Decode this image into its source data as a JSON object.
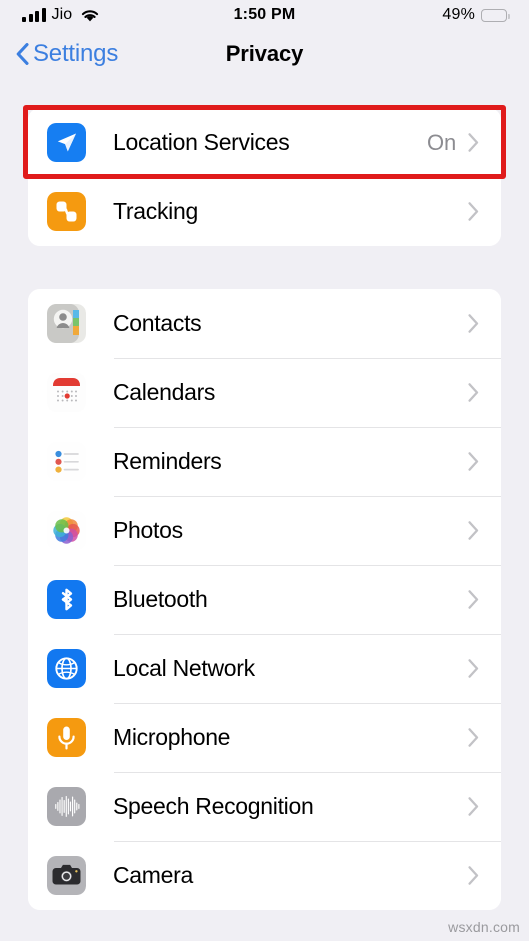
{
  "status_bar": {
    "carrier": "Jio",
    "signal_icon": "signal-bars-icon",
    "wifi_icon": "wifi-icon",
    "time": "1:50 PM",
    "battery_percent": "49%",
    "battery_icon": "battery-icon",
    "battery_level": 49
  },
  "nav": {
    "back_icon": "chevron-left-icon",
    "back_label": "Settings",
    "title": "Privacy"
  },
  "groups": [
    {
      "rows": [
        {
          "label": "Location Services",
          "value": "On",
          "icon": "location-arrow-icon",
          "icon_color": "#167ef2",
          "highlighted": true
        },
        {
          "label": "Tracking",
          "value": "",
          "icon": "tracking-icon",
          "icon_color": "#f59a10",
          "highlighted": false
        }
      ]
    },
    {
      "rows": [
        {
          "label": "Contacts",
          "value": "",
          "icon": "contacts-icon",
          "icon_color": "#c9c9c6",
          "highlighted": false
        },
        {
          "label": "Calendars",
          "value": "",
          "icon": "calendar-icon",
          "icon_color": "#ffffff",
          "highlighted": false
        },
        {
          "label": "Reminders",
          "value": "",
          "icon": "reminders-icon",
          "icon_color": "#ffffff",
          "highlighted": false
        },
        {
          "label": "Photos",
          "value": "",
          "icon": "photos-icon",
          "icon_color": "#ffffff",
          "highlighted": false
        },
        {
          "label": "Bluetooth",
          "value": "",
          "icon": "bluetooth-icon",
          "icon_color": "#1278f0",
          "highlighted": false
        },
        {
          "label": "Local Network",
          "value": "",
          "icon": "globe-icon",
          "icon_color": "#1278f0",
          "highlighted": false
        },
        {
          "label": "Microphone",
          "value": "",
          "icon": "microphone-icon",
          "icon_color": "#f59a10",
          "highlighted": false
        },
        {
          "label": "Speech Recognition",
          "value": "",
          "icon": "waveform-icon",
          "icon_color": "#a9a9ae",
          "highlighted": false
        },
        {
          "label": "Camera",
          "value": "",
          "icon": "camera-icon",
          "icon_color": "#b4b4b8",
          "highlighted": false
        }
      ]
    }
  ],
  "highlight_color": "#e01b1b",
  "accent_color": "#3c7fe0",
  "watermark": "wsxdn.com"
}
